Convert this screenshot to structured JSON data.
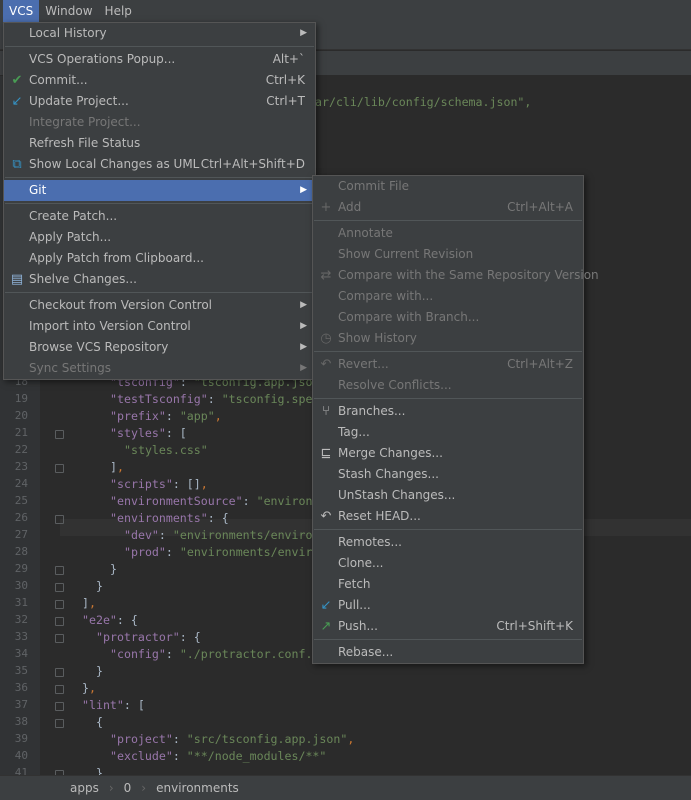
{
  "menubar": {
    "items": [
      "VCS",
      "Window",
      "Help"
    ],
    "active": "VCS"
  },
  "vcs_menu": [
    {
      "label": "Local History",
      "submenu": true
    },
    {
      "sep": true
    },
    {
      "label": "VCS Operations Popup...",
      "shortcut": "Alt+`"
    },
    {
      "label": "Commit...",
      "shortcut": "Ctrl+K",
      "icon": "check-icon",
      "icon_char": "✔",
      "icon_color": "#499c54"
    },
    {
      "label": "Update Project...",
      "shortcut": "Ctrl+T",
      "icon": "update-arrow-icon",
      "icon_char": "↙",
      "icon_color": "#3592c4"
    },
    {
      "label": "Integrate Project...",
      "disabled": true
    },
    {
      "label": "Refresh File Status"
    },
    {
      "label": "Show Local Changes as UML",
      "shortcut": "Ctrl+Alt+Shift+D",
      "icon": "uml-icon",
      "icon_char": "⧉",
      "icon_color": "#3592c4"
    },
    {
      "sep": true
    },
    {
      "label": "Git",
      "submenu": true,
      "selected": true
    },
    {
      "sep": true
    },
    {
      "label": "Create Patch..."
    },
    {
      "label": "Apply Patch..."
    },
    {
      "label": "Apply Patch from Clipboard..."
    },
    {
      "label": "Shelve Changes...",
      "icon": "shelve-icon",
      "icon_char": "▤",
      "icon_color": "#8fb3d9"
    },
    {
      "sep": true
    },
    {
      "label": "Checkout from Version Control",
      "submenu": true
    },
    {
      "label": "Import into Version Control",
      "submenu": true
    },
    {
      "label": "Browse VCS Repository",
      "submenu": true
    },
    {
      "label": "Sync Settings",
      "submenu": true,
      "disabled": true
    }
  ],
  "git_menu": [
    {
      "label": "Commit File",
      "disabled": true
    },
    {
      "label": "Add",
      "shortcut": "Ctrl+Alt+A",
      "disabled": true,
      "icon": "plus-icon",
      "icon_char": "+",
      "icon_color": "#666"
    },
    {
      "sep": true
    },
    {
      "label": "Annotate",
      "disabled": true
    },
    {
      "label": "Show Current Revision",
      "disabled": true
    },
    {
      "label": "Compare with the Same Repository Version",
      "disabled": true,
      "icon": "compare-icon",
      "icon_char": "⇄",
      "icon_color": "#666"
    },
    {
      "label": "Compare with...",
      "disabled": true
    },
    {
      "label": "Compare with Branch...",
      "disabled": true
    },
    {
      "label": "Show History",
      "disabled": true,
      "icon": "clock-icon",
      "icon_char": "◷",
      "icon_color": "#666"
    },
    {
      "sep": true
    },
    {
      "label": "Revert...",
      "shortcut": "Ctrl+Alt+Z",
      "disabled": true,
      "icon": "revert-icon",
      "icon_char": "↶",
      "icon_color": "#666"
    },
    {
      "label": "Resolve Conflicts...",
      "disabled": true
    },
    {
      "sep": true
    },
    {
      "label": "Branches...",
      "icon": "branch-icon",
      "icon_char": "⑂",
      "icon_color": "#bbbbbb"
    },
    {
      "label": "Tag..."
    },
    {
      "label": "Merge Changes...",
      "icon": "merge-icon",
      "icon_char": "⊑",
      "icon_color": "#bbbbbb"
    },
    {
      "label": "Stash Changes..."
    },
    {
      "label": "UnStash Changes..."
    },
    {
      "label": "Reset HEAD...",
      "icon": "reset-icon",
      "icon_char": "↶",
      "icon_color": "#bbbbbb"
    },
    {
      "sep": true
    },
    {
      "label": "Remotes..."
    },
    {
      "label": "Clone..."
    },
    {
      "label": "Fetch"
    },
    {
      "label": "Pull...",
      "icon": "pull-icon",
      "icon_char": "↙",
      "icon_color": "#3592c4"
    },
    {
      "label": "Push...",
      "shortcut": "Ctrl+Shift+K",
      "icon": "push-icon",
      "icon_char": "↗",
      "icon_color": "#499c54"
    },
    {
      "sep": true
    },
    {
      "label": "Rebase..."
    }
  ],
  "editor": {
    "top_fragment": "ar/cli/lib/config/schema.json\",",
    "lines": [
      {
        "n": 18,
        "indent": 10,
        "text": "\"tsconfig\": \"tsconfig.app.json\","
      },
      {
        "n": 19,
        "indent": 10,
        "text": "\"testTsconfig\": \"tsconfig.spec.json\","
      },
      {
        "n": 20,
        "indent": 10,
        "text": "\"prefix\": \"app\","
      },
      {
        "n": 21,
        "indent": 10,
        "text": "\"styles\": [",
        "fold": true
      },
      {
        "n": 22,
        "indent": 12,
        "text": "\"styles.css\""
      },
      {
        "n": 23,
        "indent": 10,
        "text": "],",
        "fold": true
      },
      {
        "n": 24,
        "indent": 10,
        "text": "\"scripts\": [],"
      },
      {
        "n": 25,
        "indent": 10,
        "text": "\"environmentSource\": \"environments/environment.ts\","
      },
      {
        "n": 26,
        "indent": 10,
        "text": "\"environments\": {",
        "fold": true
      },
      {
        "n": 27,
        "indent": 12,
        "text": "\"dev\": \"environments/environment.ts\","
      },
      {
        "n": 28,
        "indent": 12,
        "text": "\"prod\": \"environments/environment.prod.ts\""
      },
      {
        "n": 29,
        "indent": 10,
        "text": "}",
        "fold": true
      },
      {
        "n": 30,
        "indent": 8,
        "text": "}",
        "fold": true
      },
      {
        "n": 31,
        "indent": 6,
        "text": "],",
        "fold": true
      },
      {
        "n": 32,
        "indent": 6,
        "text": "\"e2e\": {",
        "fold": true
      },
      {
        "n": 33,
        "indent": 8,
        "text": "\"protractor\": {",
        "fold": true
      },
      {
        "n": 34,
        "indent": 10,
        "text": "\"config\": \"./protractor.conf.js\""
      },
      {
        "n": 35,
        "indent": 8,
        "text": "}",
        "fold": true
      },
      {
        "n": 36,
        "indent": 6,
        "text": "},",
        "fold": true
      },
      {
        "n": 37,
        "indent": 6,
        "text": "\"lint\": [",
        "fold": true
      },
      {
        "n": 38,
        "indent": 8,
        "text": "{",
        "fold": true
      },
      {
        "n": 39,
        "indent": 10,
        "text": "\"project\": \"src/tsconfig.app.json\","
      },
      {
        "n": 40,
        "indent": 10,
        "text": "\"exclude\": \"**/node_modules/**\""
      },
      {
        "n": 41,
        "indent": 8,
        "text": "},",
        "fold": true
      }
    ]
  },
  "breadcrumb": [
    "apps",
    "0",
    "environments"
  ],
  "colors": {
    "menu_bg": "#3c3f41",
    "selection": "#4b6eaf",
    "editor_bg": "#2b2b2b",
    "key": "#9876aa",
    "string": "#6a8759"
  }
}
